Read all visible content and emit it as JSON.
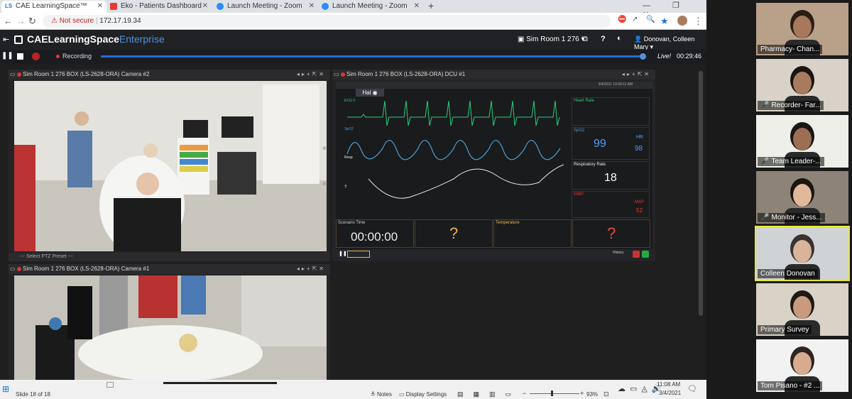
{
  "browser": {
    "tabs": [
      {
        "title": "CAE LearningSpace™",
        "color": "#1a73e8"
      },
      {
        "title": "Eko - Patients Dashboard",
        "color": "#e53935"
      },
      {
        "title": "Launch Meeting - Zoom",
        "color": "#2d8cff"
      },
      {
        "title": "Launch Meeting - Zoom",
        "color": "#2d8cff"
      }
    ],
    "not_secure": "Not secure",
    "url": "172.17.19.34"
  },
  "app": {
    "logo_main": "CAELearningSpace",
    "logo_accent": "Enterprise",
    "room_select": "Sim Room 1 276",
    "user": "Donovan, Colleen Mary",
    "recording_label": "Recording",
    "live_label": "Live!",
    "elapsed": "00:29:46"
  },
  "panes": {
    "cam2_title": "Sim Room 1 276 BOX (LS-2628-ORA) Camera #2",
    "dcu_title": "Sim Room 1 276 BOX (LS-2628-ORA) DCU #1",
    "cam1_title": "Sim Room 1 276 BOX (LS-2628-ORA) Camera #1",
    "ptz_preset": "--- Select PTZ Preset ---"
  },
  "monitor": {
    "patient": "Hal",
    "timestamp": "3/4/2021 10:09:11 AM",
    "heart_rate_label": "Heart Rate",
    "spo2_label": "SpO2",
    "spo2_value": "99",
    "hr_label": "HR",
    "hr_value": "98",
    "resp_label": "Respiratory Rate",
    "resp_value": "18",
    "nibp_label": "NIBP",
    "map_label": "MAP",
    "map_value": "52",
    "resp_trace_label": "Resp",
    "ecg_label": "ECG II",
    "spo2_trace_label": "SpO2",
    "scenario_time_label": "Scenario Time",
    "scenario_time": "00:00:00",
    "temperature_label": "Temperature",
    "unknown_a": "?",
    "unknown_b": "?",
    "unknown_c": "?",
    "history_label": "History"
  },
  "taskbar": {
    "slide": "Slide 18 of 18",
    "notes": "Notes",
    "display_settings": "Display Settings",
    "zoom_pct": "93%",
    "time": "11:08 AM",
    "date": "3/4/2021"
  },
  "zoom": {
    "participants": [
      {
        "name": "Pharmacy- Chan...",
        "muted": false,
        "bg": "#b9a089",
        "skin": "#a6785c",
        "hair": "#2a1d17"
      },
      {
        "name": "Recorder- Far...",
        "muted": true,
        "bg": "#d8d2c8",
        "skin": "#a97b5e",
        "hair": "#1a1412"
      },
      {
        "name": "Team Leader-...",
        "muted": true,
        "bg": "#efefe9",
        "skin": "#9c6e52",
        "hair": "#1a1614"
      },
      {
        "name": "Monitor - Jess...",
        "muted": true,
        "bg": "#8d8377",
        "skin": "#e0b89a",
        "hair": "#1a1412"
      },
      {
        "name": "Colleen Donovan",
        "muted": false,
        "bg": "#cfd3d6",
        "skin": "#d9b39a",
        "hair": "#3a3330"
      },
      {
        "name": "Primary Survey",
        "muted": false,
        "bg": "#d9d2c6",
        "skin": "#c99a7d",
        "hair": "#1f1916"
      },
      {
        "name": "Tom Pisano - #2 ...",
        "muted": false,
        "bg": "#f2f2f2",
        "skin": "#d9ab8e",
        "hair": "#2e2520"
      }
    ]
  }
}
